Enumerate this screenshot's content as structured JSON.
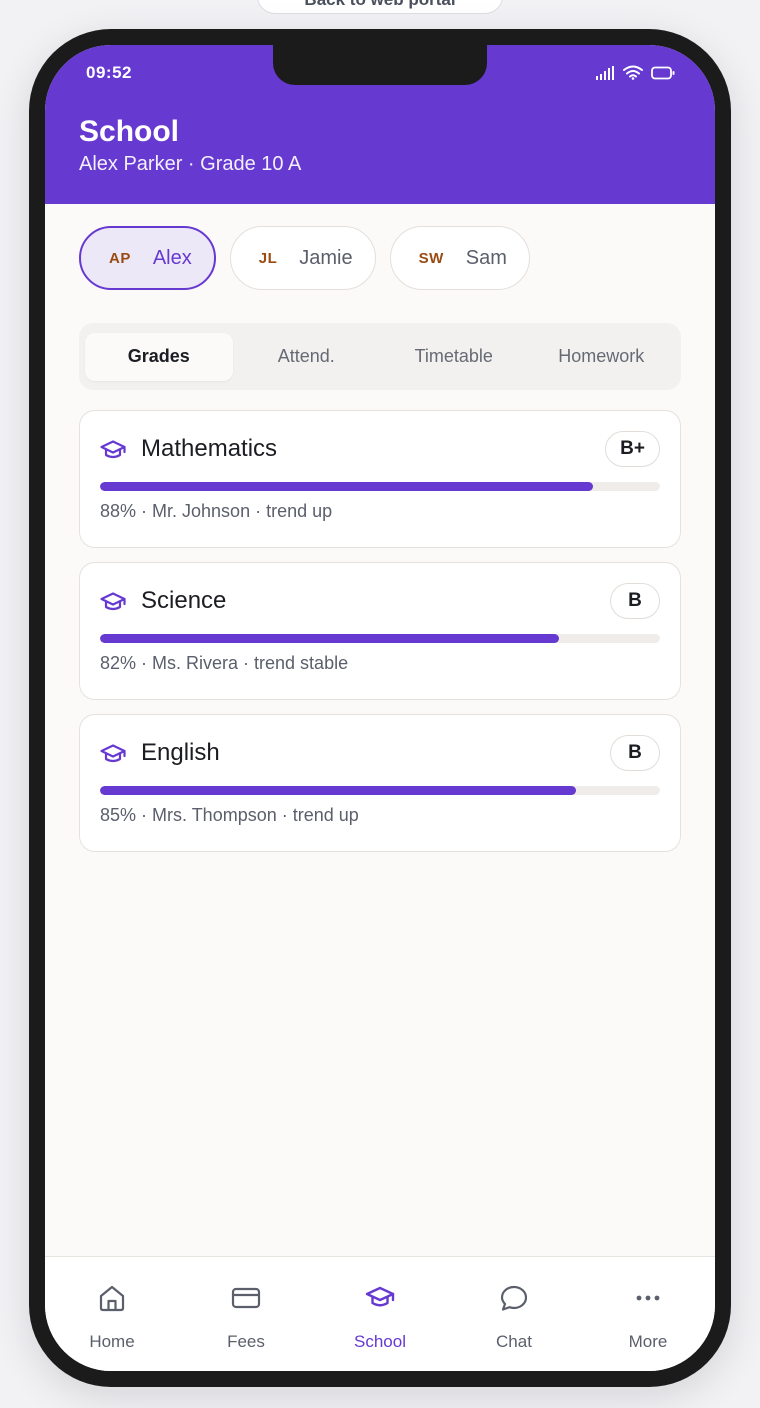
{
  "portal": {
    "back_label": "Back to web portal"
  },
  "status_bar": {
    "time": "09:52"
  },
  "header": {
    "title": "School",
    "subtitle": "Alex Parker · Grade 10 A"
  },
  "children": [
    {
      "initials": "AP",
      "name": "Alex",
      "active": true
    },
    {
      "initials": "JL",
      "name": "Jamie",
      "active": false
    },
    {
      "initials": "SW",
      "name": "Sam",
      "active": false
    }
  ],
  "tabs": [
    {
      "label": "Grades",
      "active": true
    },
    {
      "label": "Attend.",
      "active": false
    },
    {
      "label": "Timetable",
      "active": false
    },
    {
      "label": "Homework",
      "active": false
    }
  ],
  "grades": [
    {
      "subject": "Mathematics",
      "grade": "B+",
      "percent": 88,
      "meta": "88% · Mr. Johnson · trend up",
      "icon": "graduation-cap-icon"
    },
    {
      "subject": "Science",
      "grade": "B",
      "percent": 82,
      "meta": "82% · Ms. Rivera · trend stable",
      "icon": "graduation-cap-icon"
    },
    {
      "subject": "English",
      "grade": "B",
      "percent": 85,
      "meta": "85% · Mrs. Thompson · trend up",
      "icon": "graduation-cap-icon"
    }
  ],
  "nav": [
    {
      "label": "Home",
      "icon": "home-icon",
      "active": false
    },
    {
      "label": "Fees",
      "icon": "credit-card-icon",
      "active": false
    },
    {
      "label": "School",
      "icon": "graduation-cap-icon",
      "active": true
    },
    {
      "label": "Chat",
      "icon": "chat-bubble-icon",
      "active": false
    },
    {
      "label": "More",
      "icon": "more-dots-icon",
      "active": false
    }
  ],
  "colors": {
    "accent": "#6639d1",
    "initials": "#9a4b12"
  }
}
